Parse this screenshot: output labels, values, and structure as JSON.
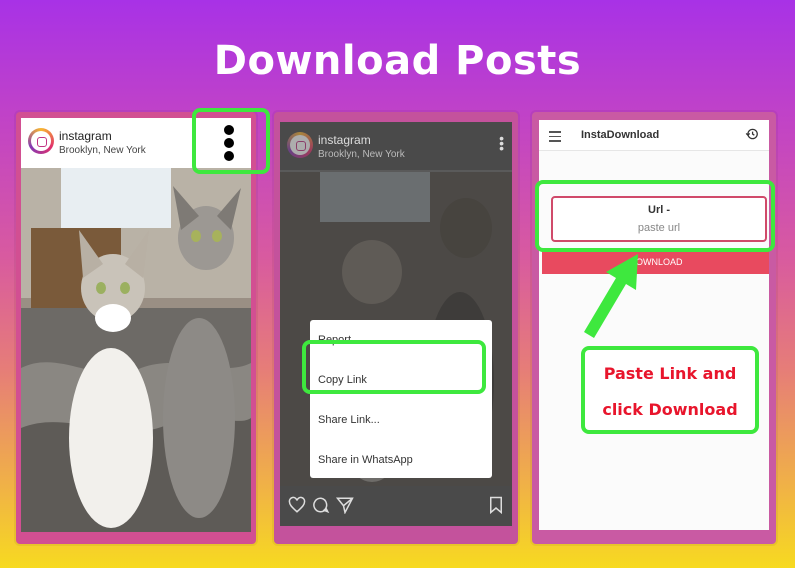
{
  "title": "Download Posts",
  "panel1": {
    "account": "instagram",
    "location": "Brooklyn, New York"
  },
  "panel2": {
    "account": "instagram",
    "location": "Brooklyn, New York",
    "menu": [
      "Report...",
      "Copy Link",
      "Share Link...",
      "Share in WhatsApp"
    ]
  },
  "panel3": {
    "app_title": "InstaDownload",
    "url_label": "Url -",
    "url_placeholder": "paste url",
    "download_label": "DOWNLOAD",
    "callout_line1": "Paste Link and",
    "callout_line2": "click Download"
  },
  "colors": {
    "highlight": "#3ee83e",
    "download_button": "#e84a5f",
    "callout_text": "#e8152c"
  }
}
